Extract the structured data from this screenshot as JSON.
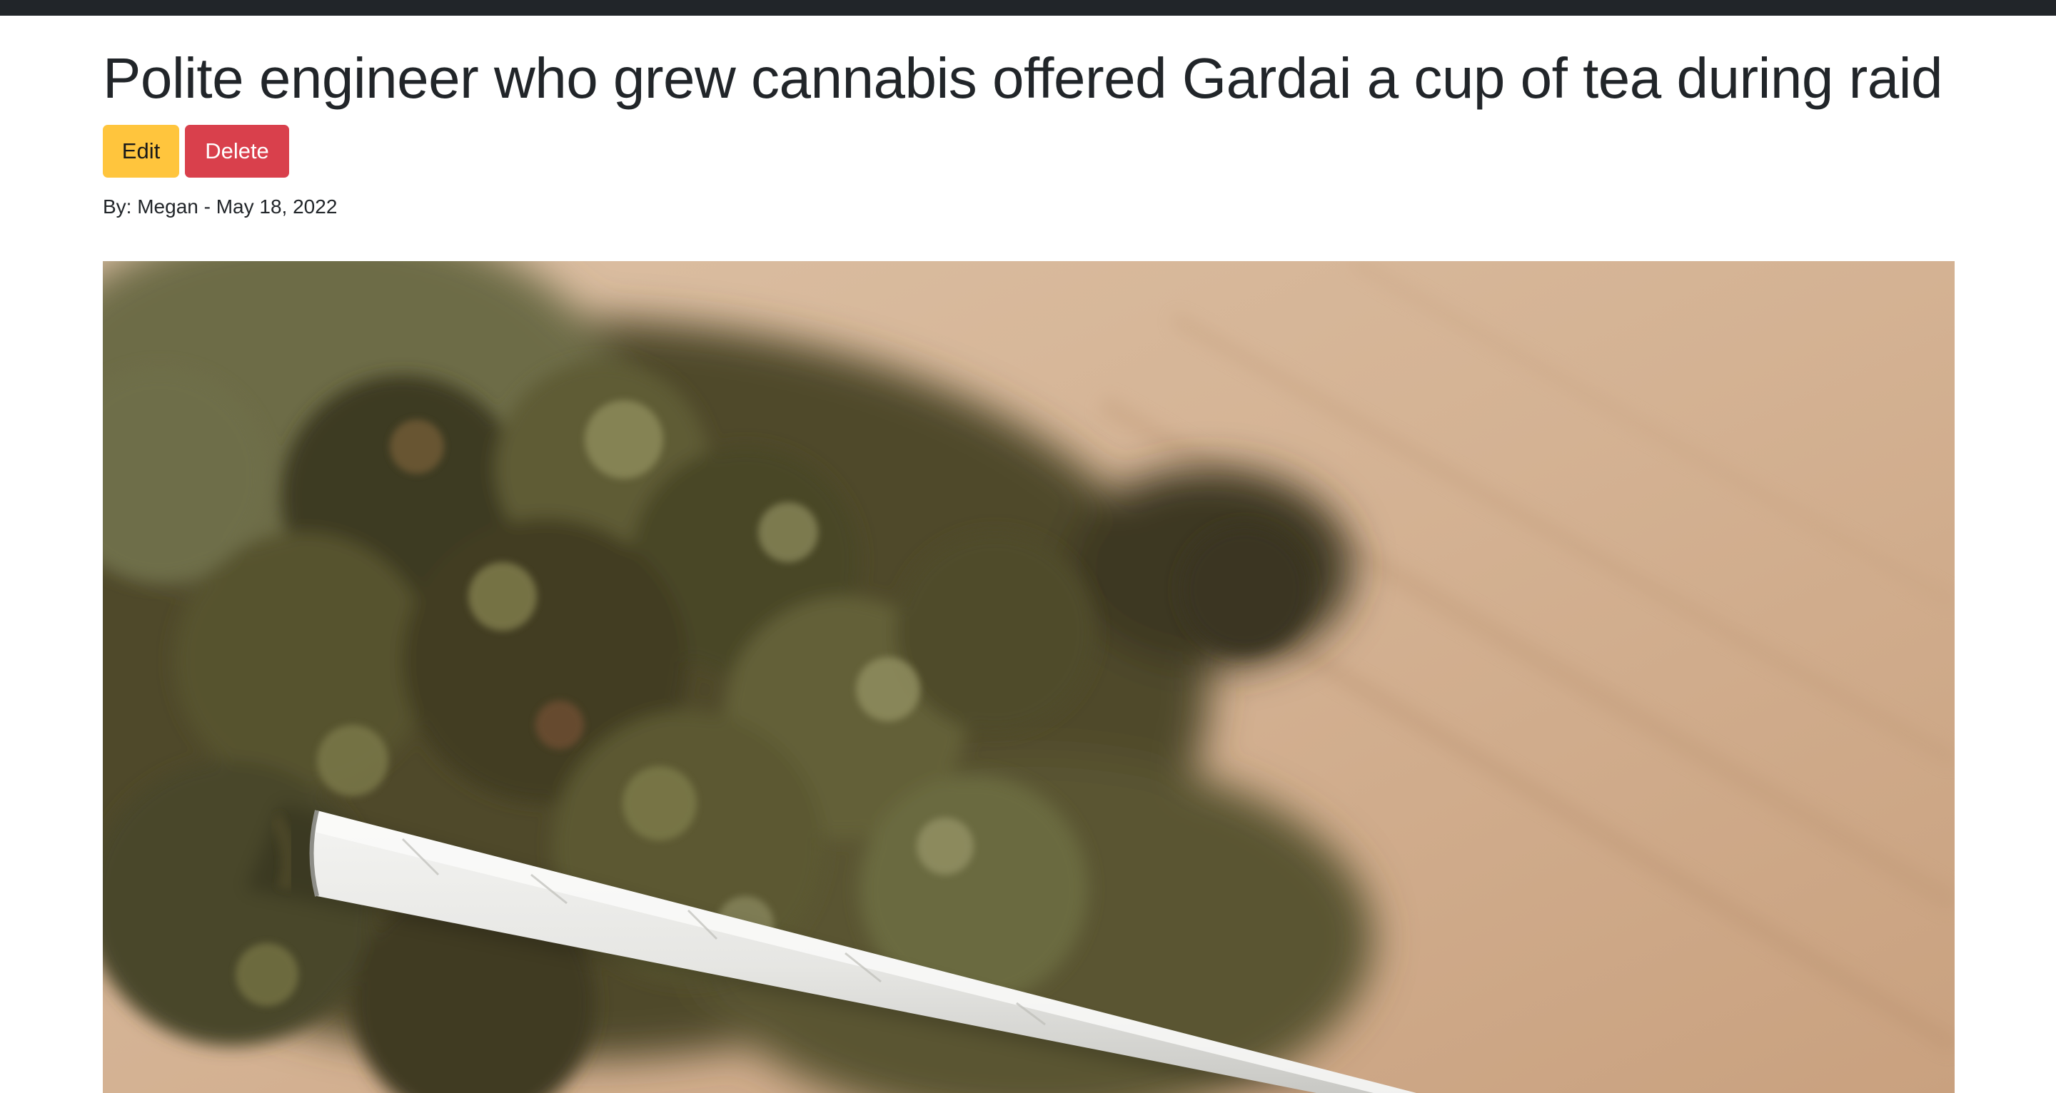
{
  "article": {
    "title": "Polite engineer who grew cannabis offered Gardai a cup of tea during raid",
    "byline": "By: Megan - May 18, 2022",
    "actions": {
      "edit_label": "Edit",
      "delete_label": "Delete"
    },
    "hero_image": {
      "subject": "cannabis buds and a rolled joint on a wooden table"
    }
  },
  "colors": {
    "navbar": "#212529",
    "edit_button": "#ffc53d",
    "delete_button": "#d9404c",
    "text": "#212529"
  }
}
